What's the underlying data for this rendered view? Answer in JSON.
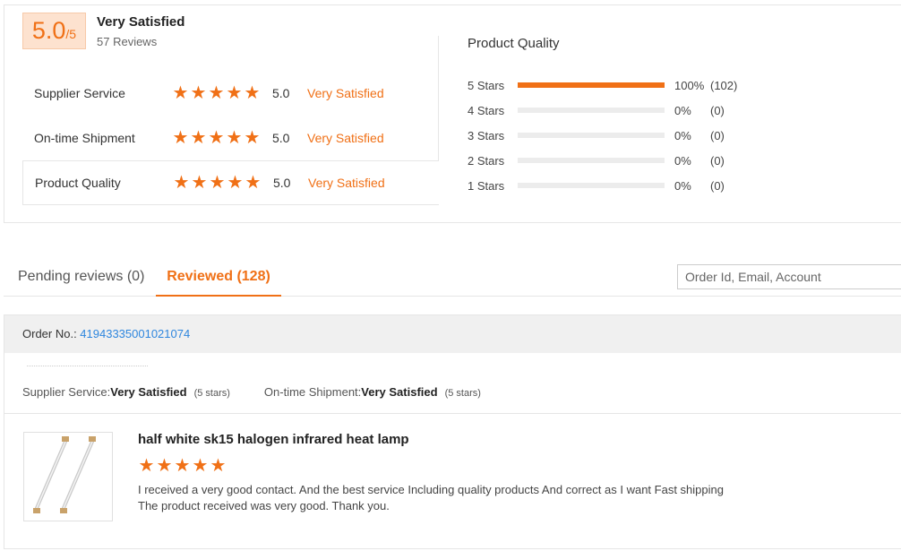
{
  "summary": {
    "score": "5.0",
    "score_suffix": "/5",
    "title": "Very Satisfied",
    "reviews_count": "57 Reviews",
    "metrics": [
      {
        "label": "Supplier Service",
        "score": "5.0",
        "text": "Very Satisfied",
        "stars": 5
      },
      {
        "label": "On-time Shipment",
        "score": "5.0",
        "text": "Very Satisfied",
        "stars": 5
      },
      {
        "label": "Product Quality",
        "score": "5.0",
        "text": "Very Satisfied",
        "stars": 5
      }
    ]
  },
  "product_quality": {
    "title": "Product Quality",
    "rows": [
      {
        "label": "5 Stars",
        "percent": "100%",
        "count": "(102)",
        "fill": 1.0
      },
      {
        "label": "4 Stars",
        "percent": "0%",
        "count": "(0)",
        "fill": 0
      },
      {
        "label": "3 Stars",
        "percent": "0%",
        "count": "(0)",
        "fill": 0
      },
      {
        "label": "2 Stars",
        "percent": "0%",
        "count": "(0)",
        "fill": 0
      },
      {
        "label": "1 Stars",
        "percent": "0%",
        "count": "(0)",
        "fill": 0
      }
    ]
  },
  "tabs": {
    "pending": "Pending reviews (0)",
    "reviewed": "Reviewed (128)"
  },
  "search": {
    "placeholder": "Order Id, Email, Account"
  },
  "review": {
    "order_label": "Order No.: ",
    "order_number": "41943335001021074",
    "supplier_label": "Supplier Service: ",
    "supplier_value": "Very Satisfied",
    "supplier_stars": "(5 stars)",
    "shipment_label": "On-time Shipment: ",
    "shipment_value": "Very Satisfied",
    "shipment_stars": "(5 stars)",
    "product_title": "half white sk15 halogen infrared heat lamp",
    "rating": 5,
    "text": "I received a very good contact.  And the best service  Including quality products  And correct as I want  Fast shipping  The product received was very good. Thank you."
  },
  "colors": {
    "accent": "#f07016",
    "link": "#2e86de"
  }
}
